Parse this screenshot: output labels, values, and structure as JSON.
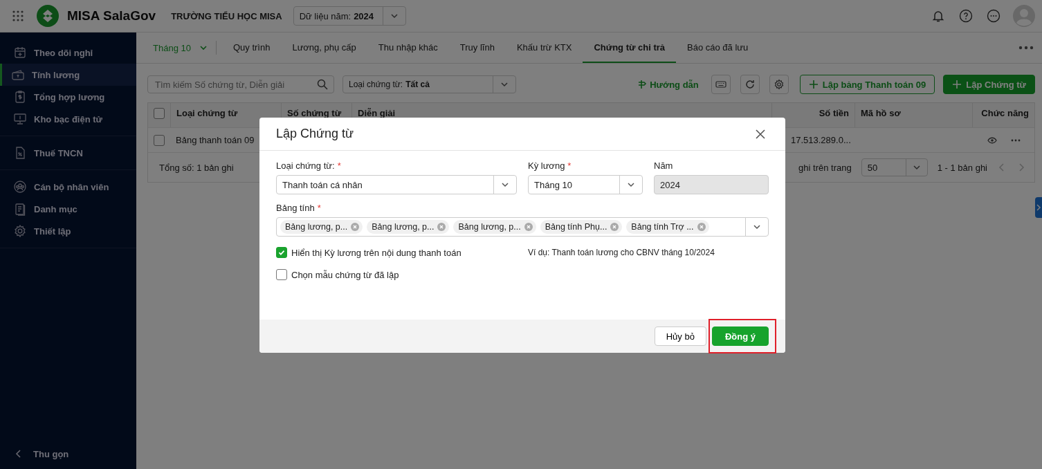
{
  "header": {
    "app_name": "MISA SalaGov",
    "organization": "TRƯỜNG TIỂU HỌC MISA",
    "year_select": {
      "label": "Dữ liệu năm:",
      "value": "2024"
    }
  },
  "sidebar": {
    "groups": [
      {
        "items": [
          {
            "label": "Theo dõi nghỉ",
            "selected": false
          },
          {
            "label": "Tính lương",
            "selected": true
          },
          {
            "label": "Tổng hợp lương",
            "selected": false
          },
          {
            "label": "Kho bạc điện tử",
            "selected": false
          }
        ]
      },
      {
        "items": [
          {
            "label": "Thuế TNCN",
            "selected": false
          }
        ]
      },
      {
        "items": [
          {
            "label": "Cán bộ nhân viên",
            "selected": false
          },
          {
            "label": "Danh mục",
            "selected": false
          },
          {
            "label": "Thiết lập",
            "selected": false
          }
        ]
      }
    ],
    "collapse_label": "Thu gọn"
  },
  "period_select": "Tháng 10",
  "tabs": [
    {
      "label": "Quy trình",
      "selected": false
    },
    {
      "label": "Lương, phụ cấp",
      "selected": false
    },
    {
      "label": "Thu nhập khác",
      "selected": false
    },
    {
      "label": "Truy lĩnh",
      "selected": false
    },
    {
      "label": "Khấu trừ KTX",
      "selected": false
    },
    {
      "label": "Chứng từ chi trả",
      "selected": true
    },
    {
      "label": "Báo cáo đã lưu",
      "selected": false
    }
  ],
  "toolbar": {
    "search_placeholder": "Tìm kiếm Số chứng từ, Diễn giải",
    "type_filter": {
      "label": "Loại chứng từ:",
      "value": "Tất cả"
    },
    "guide_link": "Hướng dẫn",
    "secondary_button": "Lập bảng Thanh toán 09",
    "primary_button": "Lập Chứng từ"
  },
  "table": {
    "all_checked": false,
    "columns": [
      "Loại chứng từ",
      "Số chứng từ",
      "Diễn giải",
      "Số tiền",
      "Mã hồ sơ",
      "Chức năng"
    ],
    "rows": [
      {
        "checked": false,
        "type": "Bảng thanh toán 09",
        "amount": "17.513.289.0..."
      }
    ],
    "footer": {
      "total": "Tổng số: 1 bản ghi",
      "page_size_label": "ghi trên trang",
      "page_size": "50",
      "range": "1 - 1 bản ghi"
    }
  },
  "dialog": {
    "title": "Lập Chứng từ",
    "voucher_type": {
      "label": "Loại chứng từ:",
      "required_mark": "*",
      "value": "Thanh toán cá nhân"
    },
    "period": {
      "label": "Kỳ lương",
      "required_mark": "*",
      "value": "Tháng 10"
    },
    "year": {
      "label": "Năm",
      "value": "2024",
      "disabled": true
    },
    "sheets": {
      "label": "Bảng tính",
      "required_mark": "*",
      "tags": [
        "Bảng lương, p...",
        "Bảng lương, p...",
        "Bảng lương, p...",
        "Bảng tính Phụ...",
        "Bảng tính Trợ ..."
      ]
    },
    "options": [
      {
        "label": "Hiển thị Kỳ lương trên nội dung thanh toán",
        "checked": true,
        "example": "Ví dụ: Thanh toán lương cho CBNV tháng 10/2024"
      },
      {
        "label": "Chọn mẫu chứng từ đã lập",
        "checked": false
      }
    ],
    "cancel_button": "Hủy bỏ",
    "ok_button": "Đồng ý"
  }
}
